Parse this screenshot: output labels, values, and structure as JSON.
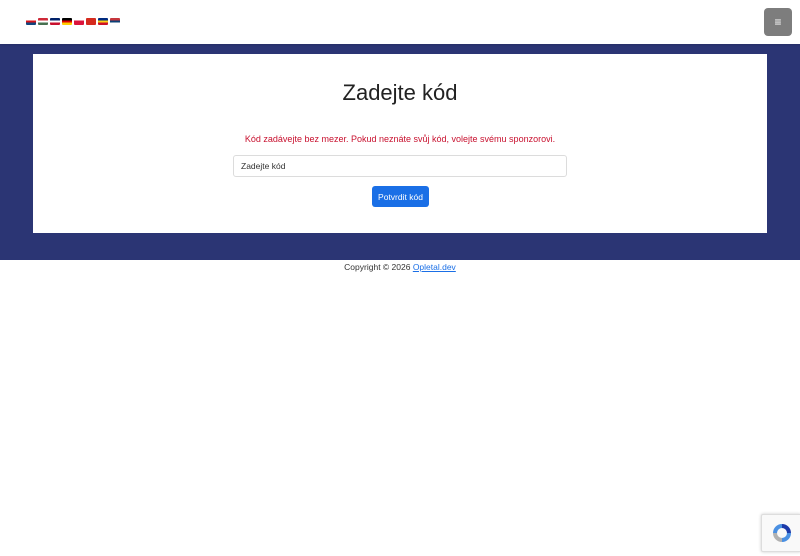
{
  "header": {
    "language_flags": [
      {
        "name": "cz-flag-icon",
        "colors": [
          "#ffffff",
          "#d7141a",
          "#11457e"
        ]
      },
      {
        "name": "hu-flag-icon",
        "colors": [
          "#ce2939",
          "#ffffff",
          "#477050"
        ]
      },
      {
        "name": "gb-flag-icon",
        "colors": [
          "#012169",
          "#ffffff",
          "#c8102e"
        ]
      },
      {
        "name": "de-flag-icon",
        "colors": [
          "#000000",
          "#dd0000",
          "#ffce00"
        ]
      },
      {
        "name": "pl-flag-icon",
        "colors": [
          "#ffffff",
          "#dc143c",
          "#dc143c"
        ]
      },
      {
        "name": "ch-flag-icon",
        "colors": [
          "#d52b1e",
          "#d52b1e",
          "#d52b1e"
        ]
      },
      {
        "name": "ro-flag-icon",
        "colors": [
          "#002b7f",
          "#fcd116",
          "#ce1126"
        ]
      },
      {
        "name": "rs-flag-icon",
        "colors": [
          "#c6363c",
          "#0c4076",
          "#ffffff"
        ]
      }
    ],
    "menu_icon": "≡"
  },
  "main": {
    "title": "Zadejte kód",
    "hint": "Kód zadávejte bez mezer. Pokud neznáte svůj kód, volejte svému sponzorovi.",
    "code_input_placeholder": "Zadejte kód",
    "submit_label": "Potvrdit kód"
  },
  "footer": {
    "copyright_text": "Copyright  © 2026 ",
    "link_text": "Opletal.dev"
  },
  "colors": {
    "band": "#2b3574",
    "hint": "#c8102e",
    "primary": "#1a6fe6",
    "menu_button": "#7d7d7d"
  }
}
